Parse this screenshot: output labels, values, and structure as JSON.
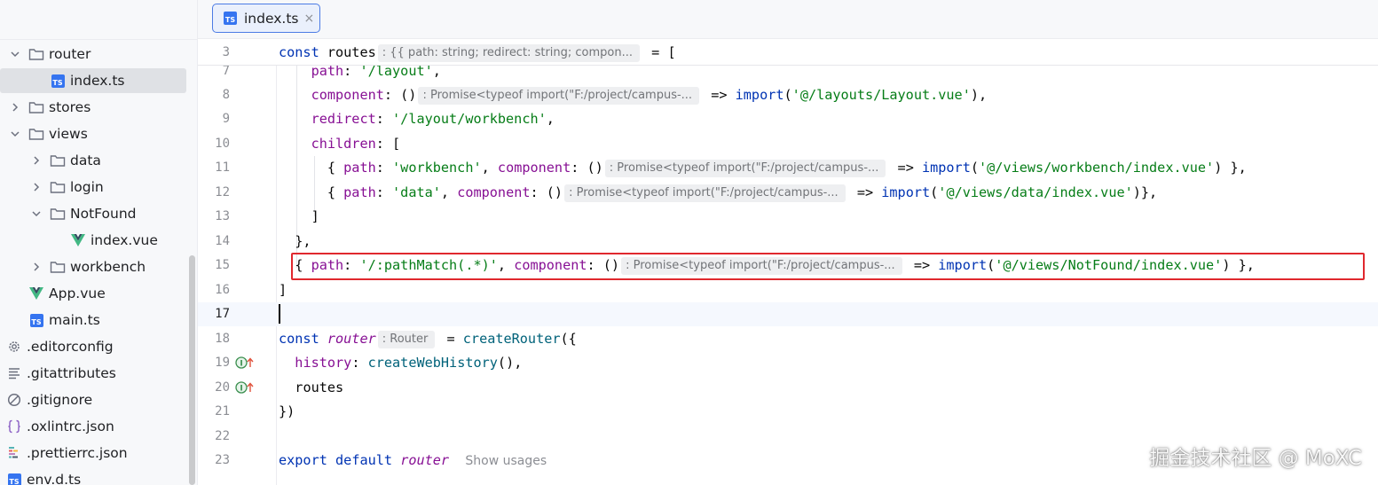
{
  "tree": {
    "items": [
      {
        "label": "router",
        "kind": "folder",
        "expanded": true
      },
      {
        "label": "index.ts",
        "kind": "ts",
        "selected": true
      },
      {
        "label": "stores",
        "kind": "folder",
        "expanded": false
      },
      {
        "label": "views",
        "kind": "folder",
        "expanded": true
      },
      {
        "label": "data",
        "kind": "folder",
        "expanded": false
      },
      {
        "label": "login",
        "kind": "folder",
        "expanded": false
      },
      {
        "label": "NotFound",
        "kind": "folder",
        "expanded": true
      },
      {
        "label": "index.vue",
        "kind": "vue"
      },
      {
        "label": "workbench",
        "kind": "folder",
        "expanded": false
      },
      {
        "label": "App.vue",
        "kind": "vue"
      },
      {
        "label": "main.ts",
        "kind": "ts"
      },
      {
        "label": ".editorconfig",
        "kind": "gear"
      },
      {
        "label": ".gitattributes",
        "kind": "lines"
      },
      {
        "label": ".gitignore",
        "kind": "ignore"
      },
      {
        "label": ".oxlintrc.json",
        "kind": "json"
      },
      {
        "label": ".prettierrc.json",
        "kind": "prettier"
      },
      {
        "label": "env.d.ts",
        "kind": "ts"
      }
    ]
  },
  "tab": {
    "label": "index.ts",
    "badge": "TS",
    "close": "×"
  },
  "editor": {
    "line_numbers": [
      "3",
      "7",
      "8",
      "9",
      "10",
      "11",
      "12",
      "13",
      "14",
      "15",
      "16",
      "17",
      "18",
      "19",
      "20",
      "21",
      "22",
      "23"
    ],
    "hints": {
      "routes_type": ": {{ path: string; redirect: string; compon...",
      "promise_type": ": Promise<typeof import(\"F:/project/campus-...",
      "router_type": ": Router"
    },
    "show_usages": "Show usages",
    "tokens": {
      "const": "const",
      "routes": "routes",
      "eq_bracket": "= [",
      "path": "path",
      "component": "component",
      "redirect": "redirect",
      "children": "children",
      "history": "history",
      "createRouter": "createRouter",
      "createWebHistory": "createWebHistory",
      "router": "router",
      "export": "export",
      "default": "default",
      "import": "import",
      "path_layout": "'/layout'",
      "path_layout_comp": "'@/layouts/Layout.vue'",
      "path_redirect": "'/layout/workbench'",
      "path_workbench": "'workbench'",
      "path_workbench_comp": "'@/views/workbench/index.vue'",
      "path_data": "'data'",
      "path_data_comp": "'@/views/data/index.vue'",
      "path_match": "'/:pathMatch(.*)'",
      "path_notfound_comp": "'@/views/NotFound/index.vue'"
    }
  },
  "watermark": "掘金技术社区 @ MoXC"
}
